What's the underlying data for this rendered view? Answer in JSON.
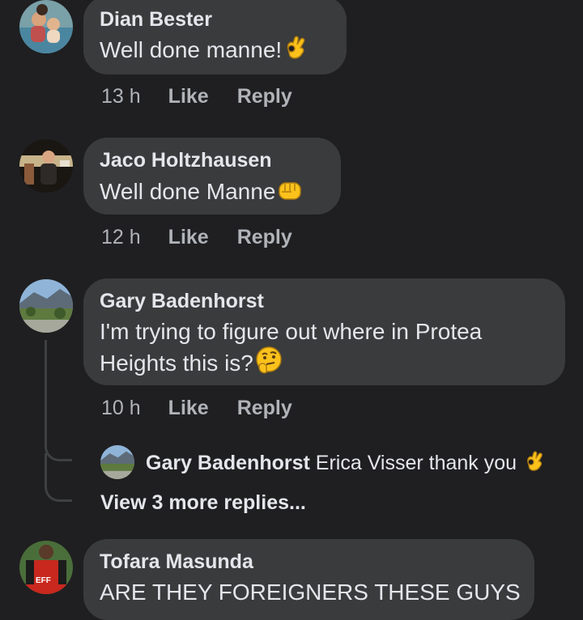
{
  "comments": [
    {
      "author": "Dian Bester",
      "text": "Well done manne!",
      "emoji": "ok-hand-emoji",
      "time": "13 h",
      "like": "Like",
      "reply": "Reply"
    },
    {
      "author": "Jaco Holtzhausen",
      "text": "Well done Manne",
      "emoji": "fist-emoji",
      "time": "12 h",
      "like": "Like",
      "reply": "Reply"
    },
    {
      "author": "Gary Badenhorst",
      "text_line1": "I'm trying to figure out where in Protea",
      "text_line2": "Heights this is?",
      "emoji": "thinking-face-emoji",
      "time": "10 h",
      "like": "Like",
      "reply": "Reply",
      "replies": [
        {
          "author": "Gary Badenhorst",
          "text": "Erica Visser thank you",
          "emoji": "ok-hand-emoji"
        }
      ],
      "more_replies": "View 3 more replies..."
    },
    {
      "author": "Tofara Masunda",
      "text": "ARE THEY FOREIGNERS THESE GUYS"
    }
  ],
  "colors": {
    "background": "#1f1f21",
    "bubble": "#3a3b3c",
    "primary_text": "#e4e6eb",
    "secondary_text": "#b0b3b8"
  }
}
